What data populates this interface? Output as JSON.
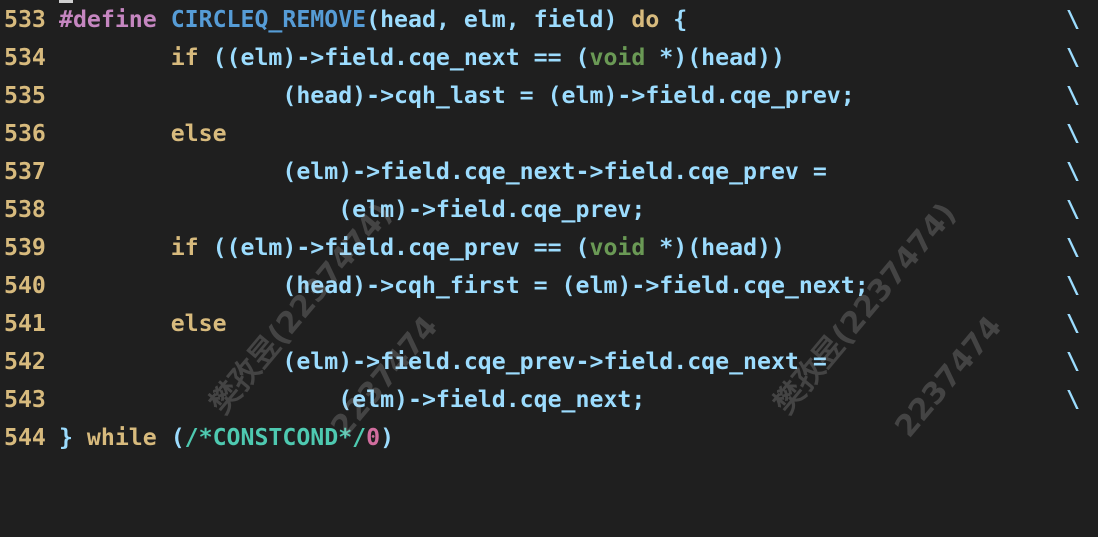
{
  "editor": {
    "continuation_char": "\\",
    "lines": [
      {
        "number": "533",
        "tokens": [
          {
            "t": "#define ",
            "k": "define"
          },
          {
            "t": "CIRCLEQ_REMOVE",
            "k": "macro"
          },
          {
            "t": "(head, elm, field) ",
            "k": "plain"
          },
          {
            "t": "do",
            "k": "ctrl"
          },
          {
            "t": " {",
            "k": "plain"
          }
        ],
        "cont": true
      },
      {
        "number": "534",
        "tokens": [
          {
            "t": "        ",
            "k": "plain"
          },
          {
            "t": "if",
            "k": "ctrl"
          },
          {
            "t": " ((elm)->field.cqe_next == (",
            "k": "plain"
          },
          {
            "t": "void",
            "k": "type"
          },
          {
            "t": " *)(head))",
            "k": "plain"
          }
        ],
        "cont": true
      },
      {
        "number": "535",
        "tokens": [
          {
            "t": "                (head)->cqh_last = (elm)->field.cqe_prev;",
            "k": "plain"
          }
        ],
        "cont": true
      },
      {
        "number": "536",
        "tokens": [
          {
            "t": "        ",
            "k": "plain"
          },
          {
            "t": "else",
            "k": "ctrl"
          }
        ],
        "cont": true
      },
      {
        "number": "537",
        "tokens": [
          {
            "t": "                (elm)->field.cqe_next->field.cqe_prev =",
            "k": "plain"
          }
        ],
        "cont": true
      },
      {
        "number": "538",
        "tokens": [
          {
            "t": "                    (elm)->field.cqe_prev;",
            "k": "plain"
          }
        ],
        "cont": true
      },
      {
        "number": "539",
        "tokens": [
          {
            "t": "        ",
            "k": "plain"
          },
          {
            "t": "if",
            "k": "ctrl"
          },
          {
            "t": " ((elm)->field.cqe_prev == (",
            "k": "plain"
          },
          {
            "t": "void",
            "k": "type"
          },
          {
            "t": " *)(head))",
            "k": "plain"
          }
        ],
        "cont": true
      },
      {
        "number": "540",
        "tokens": [
          {
            "t": "                (head)->cqh_first = (elm)->field.cqe_next;",
            "k": "plain"
          }
        ],
        "cont": true
      },
      {
        "number": "541",
        "tokens": [
          {
            "t": "        ",
            "k": "plain"
          },
          {
            "t": "else",
            "k": "ctrl"
          }
        ],
        "cont": true
      },
      {
        "number": "542",
        "tokens": [
          {
            "t": "                (elm)->field.cqe_prev->field.cqe_next =",
            "k": "plain"
          }
        ],
        "cont": true
      },
      {
        "number": "543",
        "tokens": [
          {
            "t": "                    (elm)->field.cqe_next;",
            "k": "plain"
          }
        ],
        "cont": true
      },
      {
        "number": "544",
        "tokens": [
          {
            "t": "} ",
            "k": "plain"
          },
          {
            "t": "while",
            "k": "ctrl"
          },
          {
            "t": " (",
            "k": "plain"
          },
          {
            "t": "/*CONSTCOND*/",
            "k": "comment"
          },
          {
            "t": "0",
            "k": "number"
          },
          {
            "t": ")",
            "k": "plain"
          }
        ],
        "cont": false
      }
    ]
  },
  "watermarks": [
    {
      "line1": "樊孜昱(2237474)",
      "line2": "2237474"
    },
    {
      "line1": "樊孜昱(2237474)",
      "line2": "2237474"
    }
  ],
  "colors": {
    "background": "#1f1f1f",
    "line_number": "#d7ba7d",
    "identifier": "#9cdcfe",
    "control_keyword": "#d7ba7d",
    "macro_name": "#569cd6",
    "type_keyword": "#6a9955",
    "comment": "#4ec9b0",
    "number": "#d16d9e"
  }
}
